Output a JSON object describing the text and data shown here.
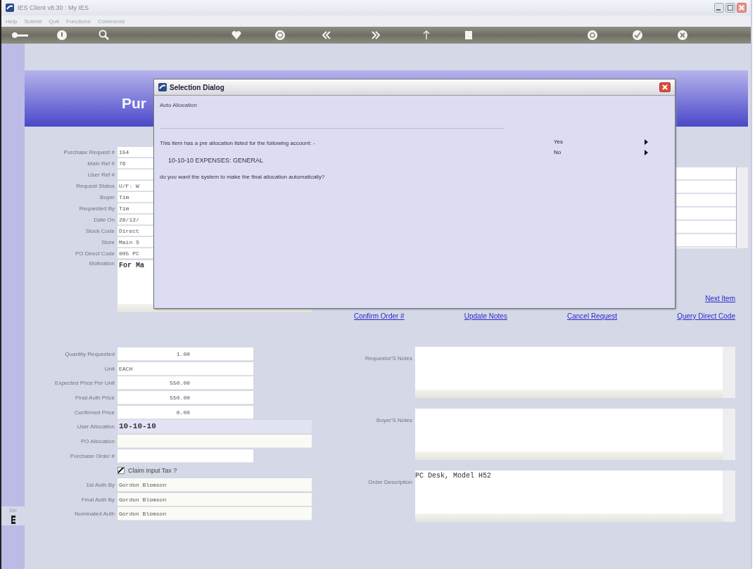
{
  "window": {
    "title": "IES Client v8.30 : My IES"
  },
  "menu": [
    {
      "label": "Help"
    },
    {
      "label": "Submit"
    },
    {
      "label": "Quit"
    },
    {
      "label": "Functions"
    },
    {
      "label": "Comments"
    }
  ],
  "header": {
    "title": "Pur"
  },
  "request_fields": [
    {
      "label": "Purchase Request #",
      "value": "154"
    },
    {
      "label": "Main Ref #",
      "value": "76"
    },
    {
      "label": "User Ref #"
    },
    {
      "label": "Request Status",
      "value": "U/F: W"
    },
    {
      "label": "Buyer",
      "value": "Tim"
    },
    {
      "label": "Requested By",
      "value": "Tim"
    },
    {
      "label": "Date On",
      "value": "28/12/"
    },
    {
      "label": "Stock Code",
      "value": "Direct"
    },
    {
      "label": "Store",
      "value": "Main S"
    },
    {
      "label": "PO Direct Code",
      "value": "005 PC"
    }
  ],
  "motivation": {
    "label": "Motivation",
    "value": "For Ma"
  },
  "next_link": {
    "label": "Next Item"
  },
  "actions": [
    {
      "label": "Confirm Order #"
    },
    {
      "label": "Update Notes"
    },
    {
      "label": "Cancel Request"
    },
    {
      "label": "Query Direct Code"
    }
  ],
  "item_fields": [
    {
      "kind": "number",
      "label": "Quantity Requested",
      "value": "1.00"
    },
    {
      "kind": "text",
      "label": "Unit",
      "value": "EACH"
    },
    {
      "kind": "number",
      "label": "Expected Price Per Unit",
      "value": "550.00"
    },
    {
      "kind": "number",
      "label": "Final Auth Price",
      "value": "550.00"
    },
    {
      "kind": "number",
      "label": "Confirmed Price",
      "value": "0.00"
    },
    {
      "kind": "allocation",
      "label": "User Allocation",
      "value": "10-10-10"
    },
    {
      "kind": "wide",
      "label": "PO Allocation"
    },
    {
      "kind": "text",
      "label": "Purchase Order #"
    },
    {
      "kind": "checkbox",
      "label": "Claim Input Tax ?",
      "checked": true
    },
    {
      "kind": "wide",
      "label": "1st Auth By",
      "value": "Gordon Blomson"
    },
    {
      "kind": "wide",
      "label": "Final Auth By",
      "value": "Gordon Blomson"
    },
    {
      "kind": "wide",
      "label": "Nominated Auth",
      "value": "Gordon Blomson"
    }
  ],
  "notes": [
    {
      "label": "Requestor'S Notes"
    },
    {
      "label": "Buyer'S Notes"
    },
    {
      "label": "Order Description",
      "value": "PC Desk, Model H52"
    }
  ],
  "side_tab": "Ser",
  "dialog": {
    "title": "Selection Dialog",
    "heading": "Auto Allocation",
    "message": "This item has a pre allocation listed for the following account: -",
    "account": "10-10-10 EXPENSES: GENERAL",
    "question": "do you want the system to make the final allocation automatically?",
    "options": [
      {
        "label": "Yes"
      },
      {
        "label": "No"
      }
    ]
  }
}
